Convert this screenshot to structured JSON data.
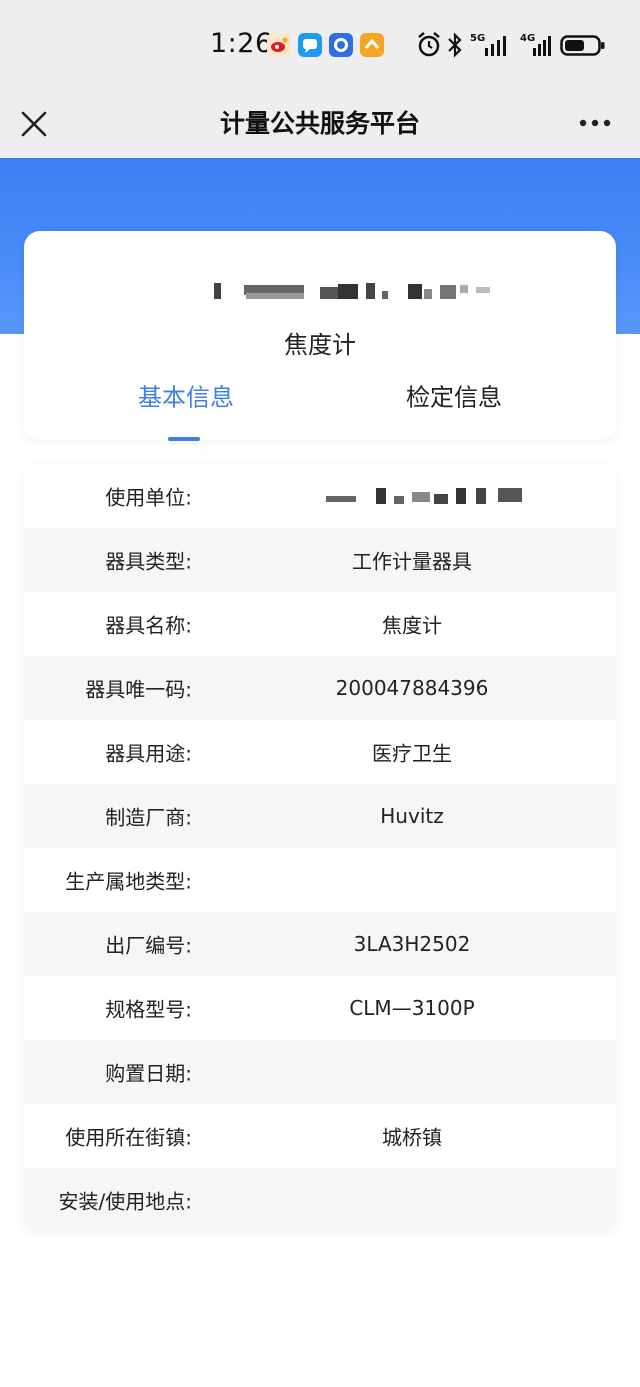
{
  "status_bar": {
    "time": "1:26",
    "network_1": "5G",
    "network_2": "4G",
    "app_icons": [
      "weibo-icon",
      "message-icon",
      "app-icon",
      "app-icon"
    ],
    "status_icons": [
      "alarm-icon",
      "bluetooth-icon",
      "signal-icon",
      "signal-icon",
      "battery-icon"
    ]
  },
  "nav": {
    "title": "计量公共服务平台"
  },
  "header": {
    "device_name": "焦度计"
  },
  "tabs": [
    {
      "label": "基本信息",
      "active": true
    },
    {
      "label": "检定信息",
      "active": false
    }
  ],
  "info_rows": [
    {
      "label": "使用单位:",
      "value": ""
    },
    {
      "label": "器具类型:",
      "value": "工作计量器具"
    },
    {
      "label": "器具名称:",
      "value": "焦度计"
    },
    {
      "label": "器具唯一码:",
      "value": "200047884396"
    },
    {
      "label": "器具用途:",
      "value": "医疗卫生"
    },
    {
      "label": "制造厂商:",
      "value": "Huvitz"
    },
    {
      "label": "生产属地类型:",
      "value": ""
    },
    {
      "label": "出厂编号:",
      "value": "3LA3H2502"
    },
    {
      "label": "规格型号:",
      "value": "CLM—3100P"
    },
    {
      "label": "购置日期:",
      "value": ""
    },
    {
      "label": "使用所在街镇:",
      "value": "城桥镇"
    },
    {
      "label": "安装/使用地点:",
      "value": ""
    }
  ],
  "colors": {
    "accent": "#3e7fe8",
    "hero_blue": "#4a8cf8",
    "page_bg": "#ffffff",
    "bar_bg": "#eeeef0",
    "stripe": "#f5f6f8"
  }
}
